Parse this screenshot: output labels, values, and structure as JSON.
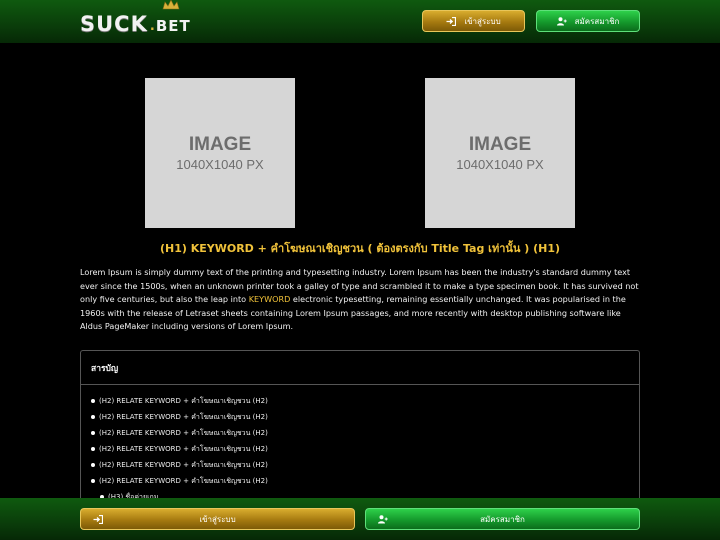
{
  "header": {
    "logo": {
      "main": "SUCK",
      "dot": ".",
      "suffix": "BET"
    },
    "login_label": "เข้าสู่ระบบ",
    "register_label": "สมัครสมาชิก"
  },
  "images": [
    {
      "title": "IMAGE",
      "size": "1040X1040 PX"
    },
    {
      "title": "IMAGE",
      "size": "1040X1040 PX"
    }
  ],
  "content": {
    "h1": "(H1) KEYWORD + คำโฆษณาเชิญชวน ( ต้องตรงกับ Title Tag เท่านั้น ) (H1)",
    "paragraph_before": "Lorem Ipsum is simply dummy text of the printing and typesetting industry. Lorem Ipsum has been the industry's standard dummy text ever since the 1500s, when an unknown printer took a galley of type and scrambled it to make a type specimen book. It has survived not only five centuries, but also the leap into ",
    "paragraph_keyword": "KEYWORD",
    "paragraph_after": " electronic typesetting, remaining essentially unchanged. It was popularised in the 1960s with the release of Letraset sheets containing Lorem Ipsum passages, and more recently with desktop publishing software like Aldus PageMaker including versions of Lorem Ipsum."
  },
  "toc": {
    "title": "สารบัญ",
    "items": [
      "(H2) RELATE KEYWORD + คำโฆษณาเชิญชวน (H2)",
      "(H2) RELATE KEYWORD + คำโฆษณาเชิญชวน (H2)",
      "(H2) RELATE KEYWORD + คำโฆษณาเชิญชวน (H2)",
      "(H2) RELATE KEYWORD + คำโฆษณาเชิญชวน (H2)",
      "(H2) RELATE KEYWORD + คำโฆษณาเชิญชวน (H2)",
      "(H2) RELATE KEYWORD + คำโฆษณาเชิญชวน (H2)"
    ],
    "sub_item": "(H3) ชื่อค่ายเกม"
  },
  "bottom_bar": {
    "login_label": "เข้าสู่ระบบ",
    "register_label": "สมัครสมาชิก"
  },
  "icons": {
    "login": "sign-in-icon",
    "register": "user-plus-icon"
  },
  "colors": {
    "accent_gold": "#f0c23a",
    "header_green": "#0a3d0a",
    "button_green": "#159a2c",
    "button_gold": "#a67a10"
  }
}
